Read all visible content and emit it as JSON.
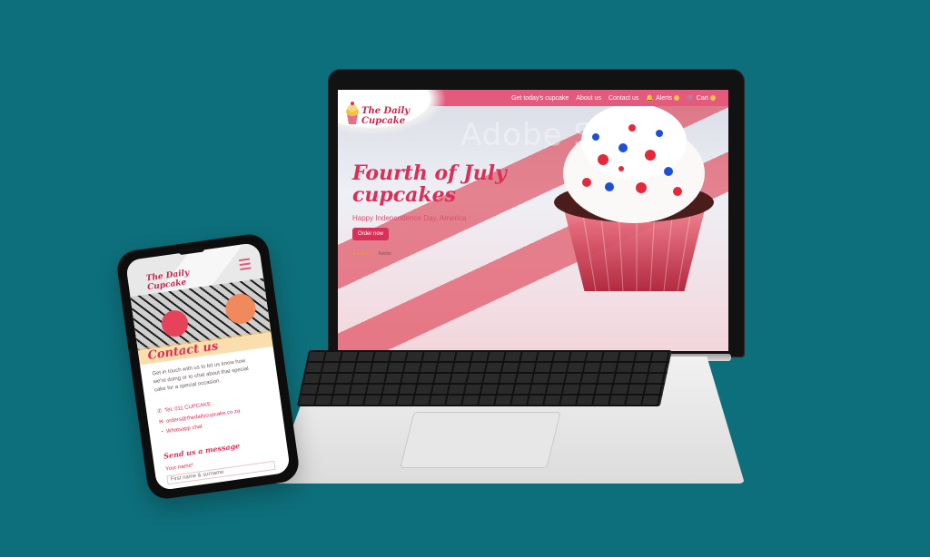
{
  "laptop": {
    "nav": {
      "items": [
        "Get today's cupcake",
        "About us",
        "Contact us",
        "Alerts",
        "Cart"
      ]
    },
    "logo": {
      "line1": "The Daily",
      "line2": "Cupcake"
    },
    "hero": {
      "title": "Fourth of July cupcakes",
      "subtitle": "Happy Independence Day, America",
      "button_label": "Order now",
      "rating_label": "★★★★☆",
      "source_label": "Adobe"
    },
    "watermark": "Adobe Stock"
  },
  "phone": {
    "logo": {
      "line1": "The Daily",
      "line2": "Cupcake"
    },
    "contact": {
      "title": "Contact us",
      "intro": "Get in touch with us to let us know how we're doing or to chat about that special cake for a special occasion.",
      "phone": "Tel: 011 CUPCAKE",
      "email": "orders@thedailycupcake.co.za",
      "whatsapp": "Whatsapp chat"
    },
    "form": {
      "title": "Send us a message",
      "name_label": "Your name*",
      "name_placeholder": "First name & surname"
    }
  },
  "colors": {
    "background": "#0d6f7b",
    "brand_pink": "#e35a7c",
    "brand_red": "#d92f58",
    "accent_yellow": "#f3c24b"
  }
}
